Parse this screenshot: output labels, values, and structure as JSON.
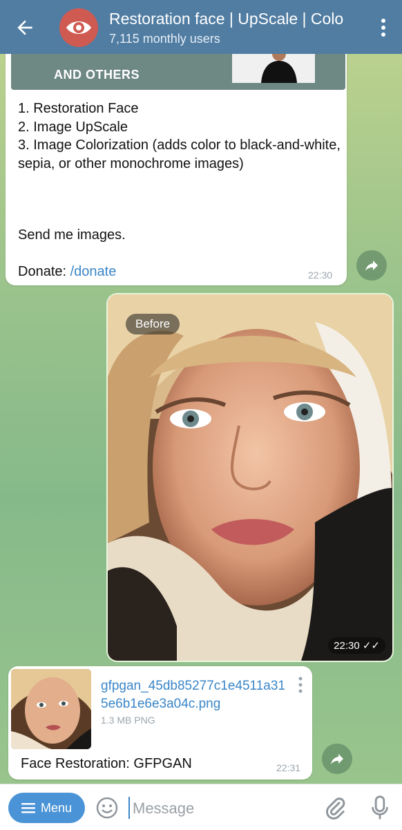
{
  "header": {
    "title": "Restoration face | UpScale | Colo",
    "subtitle": "7,115 monthly users"
  },
  "message1": {
    "banner_text": "AND OTHERS",
    "list": [
      "1. Restoration Face",
      "2. Image UpScale",
      "3. Image Colorization (adds color to black-and-white, sepia, or other monochrome images)"
    ],
    "send_text": "Send me images.",
    "donate_label": "Donate: ",
    "donate_link": "/donate",
    "time": "22:30"
  },
  "photo_message": {
    "badge": "Before",
    "time": "22:30 ✓✓"
  },
  "file_message": {
    "filename": "gfpgan_45db85277c1e4511a315e6b1e6e3a04c.png",
    "size": "1.3 MB PNG",
    "caption": "Face Restoration: GFPGAN",
    "time": "22:31"
  },
  "input": {
    "menu_label": "Menu",
    "placeholder": "Message"
  },
  "colors": {
    "header_bg": "#517da2",
    "link": "#3a86c8",
    "menu_button": "#4a93d6",
    "avatar": "#cf5a52"
  }
}
